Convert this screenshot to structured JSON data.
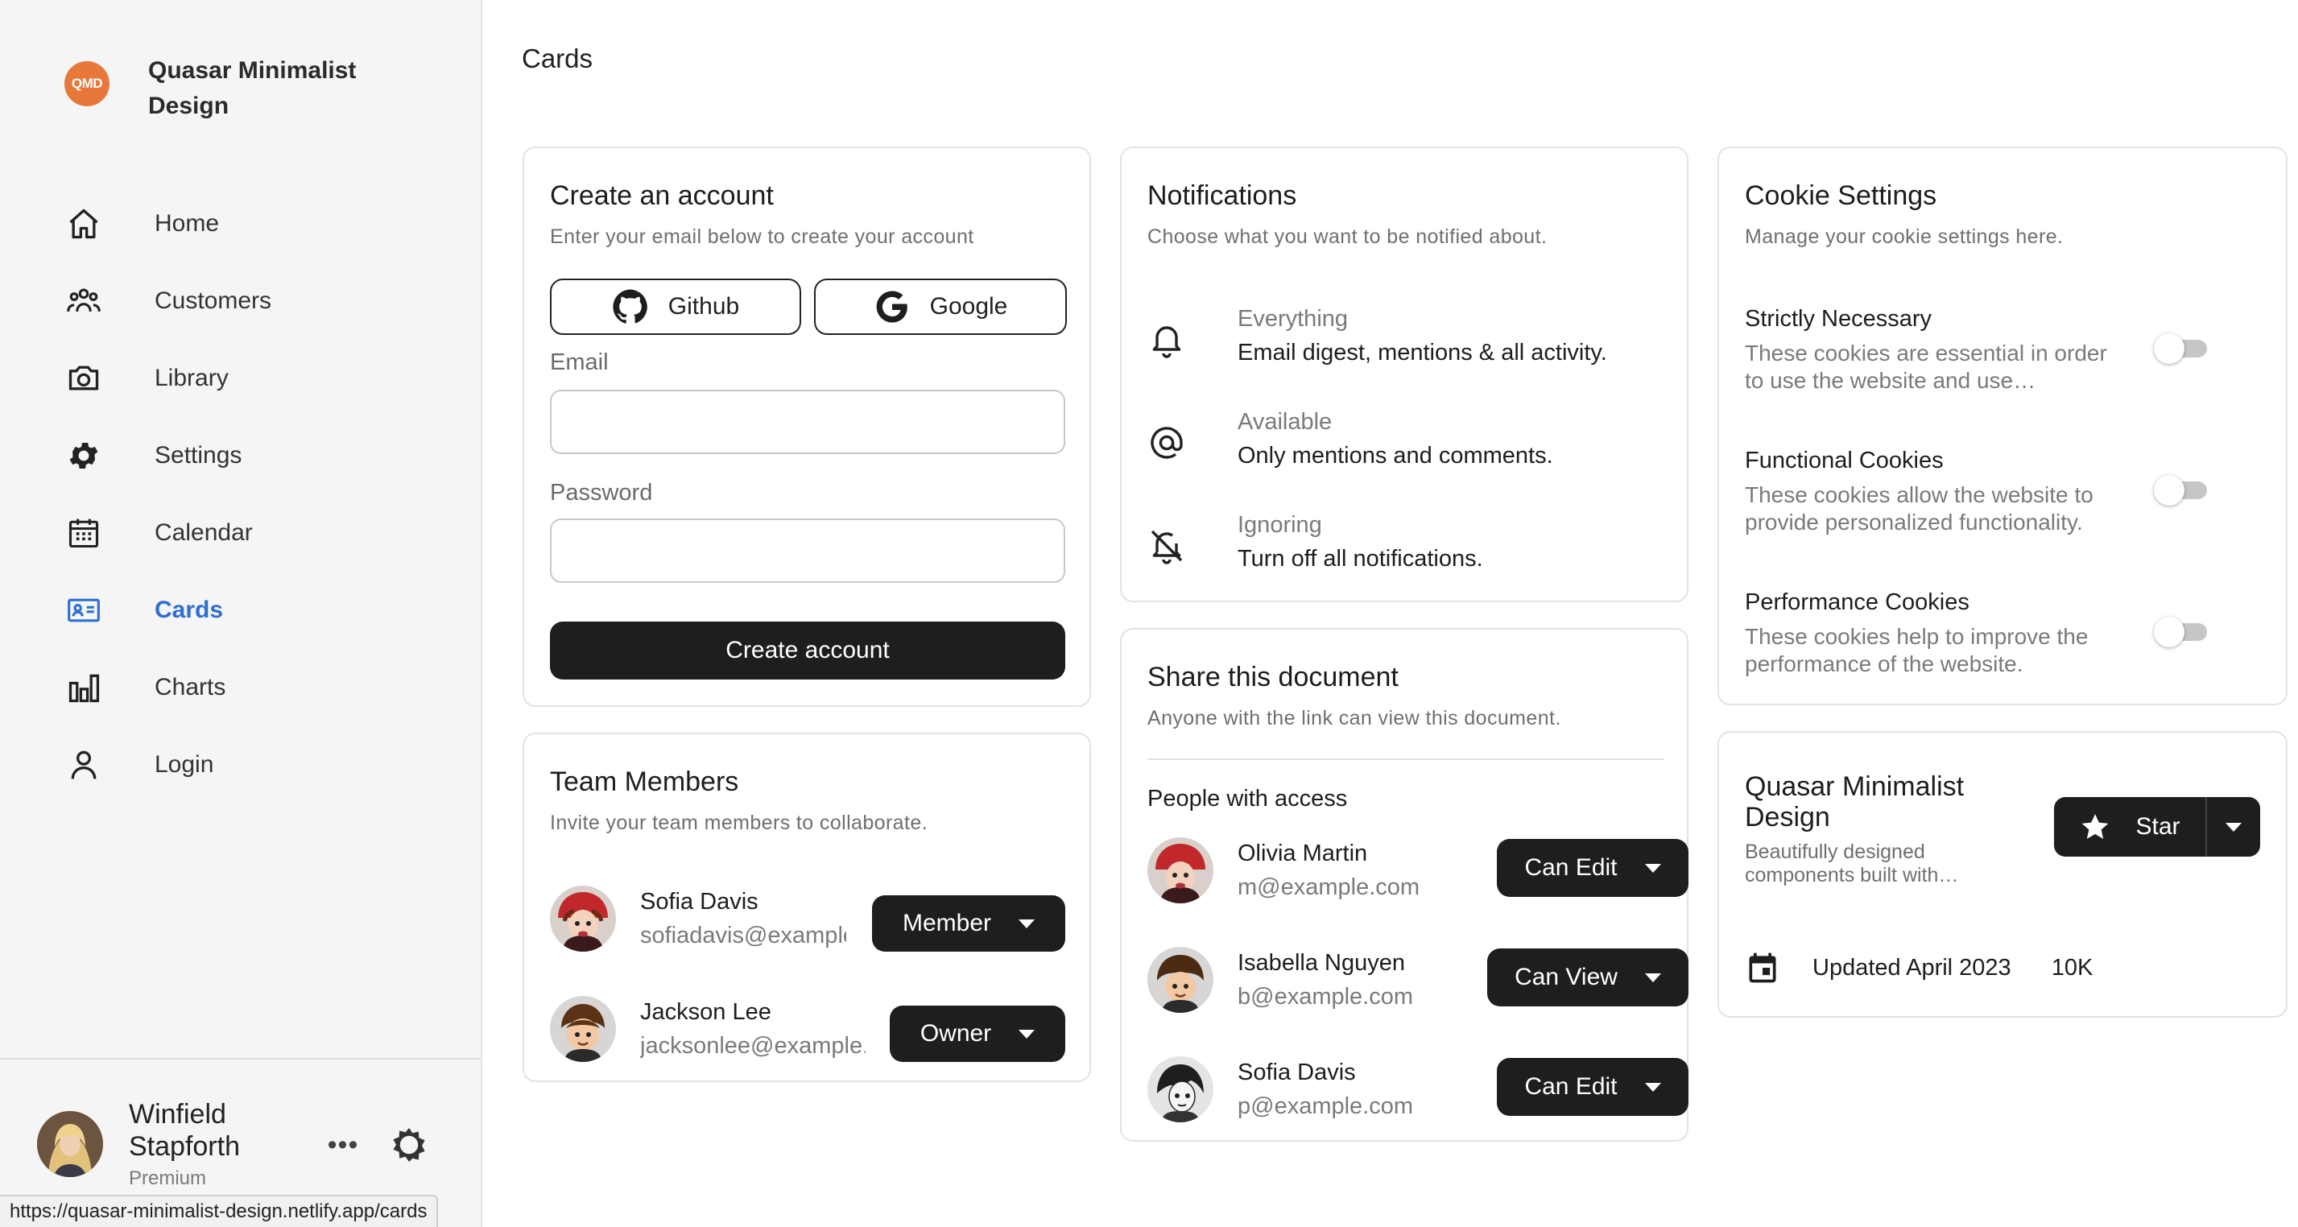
{
  "app": {
    "logo_text": "QMD",
    "brand_name": "Quasar Minimalist Design"
  },
  "sidebar": {
    "items": [
      {
        "label": "Home",
        "icon": "home-icon"
      },
      {
        "label": "Customers",
        "icon": "people-icon"
      },
      {
        "label": "Library",
        "icon": "camera-icon"
      },
      {
        "label": "Settings",
        "icon": "gear-icon"
      },
      {
        "label": "Calendar",
        "icon": "calendar-icon"
      },
      {
        "label": "Cards",
        "icon": "id-card-icon",
        "active": true
      },
      {
        "label": "Charts",
        "icon": "bar-chart-icon"
      },
      {
        "label": "Login",
        "icon": "person-icon"
      }
    ],
    "active_color": "#2f6fcf"
  },
  "user": {
    "name": "Winfield Stapforth",
    "plan": "Premium",
    "more_label": "•••"
  },
  "status_bar": {
    "url": "https://quasar-minimalist-design.netlify.app/cards"
  },
  "page": {
    "title": "Cards"
  },
  "create_account": {
    "title": "Create an account",
    "subtitle": "Enter your email below to create your account",
    "github_label": "Github",
    "google_label": "Google",
    "email_label": "Email",
    "email_value": "",
    "password_label": "Password",
    "password_value": "",
    "submit_label": "Create account"
  },
  "team": {
    "title": "Team Members",
    "subtitle": "Invite your team members to collaborate.",
    "members": [
      {
        "name": "Sofia Davis",
        "email": "sofiadavis@example.com",
        "role": "Member"
      },
      {
        "name": "Jackson Lee",
        "email": "jacksonlee@example.com",
        "role": "Owner"
      }
    ]
  },
  "notifications": {
    "title": "Notifications",
    "subtitle": "Choose what you want to be notified about.",
    "items": [
      {
        "heading": "Everything",
        "description": "Email digest, mentions & all activity.",
        "icon": "bell-icon"
      },
      {
        "heading": "Available",
        "description": "Only mentions and comments.",
        "icon": "at-sign-icon"
      },
      {
        "heading": "Ignoring",
        "description": "Turn off all notifications.",
        "icon": "bell-off-icon"
      }
    ]
  },
  "share": {
    "title": "Share this document",
    "subtitle": "Anyone with the link can view this document.",
    "people_heading": "People with access",
    "people": [
      {
        "name": "Olivia Martin",
        "email": "m@example.com",
        "permission": "Can Edit"
      },
      {
        "name": "Isabella Nguyen",
        "email": "b@example.com",
        "permission": "Can View"
      },
      {
        "name": "Sofia Davis",
        "email": "p@example.com",
        "permission": "Can Edit"
      }
    ]
  },
  "cookies": {
    "title": "Cookie Settings",
    "subtitle": "Manage your cookie settings here.",
    "items": [
      {
        "title": "Strictly Necessary",
        "description": "These cookies are essential in order to use the website and use…",
        "enabled": false
      },
      {
        "title": "Functional Cookies",
        "description": "These cookies allow the website to provide personalized functionality.",
        "enabled": false
      },
      {
        "title": "Performance Cookies",
        "description": "These cookies help to improve the performance of the website.",
        "enabled": false
      }
    ]
  },
  "repo": {
    "name": "Quasar Minimalist Design",
    "description": "Beautifully designed components built with…",
    "star_label": "Star",
    "updated": "Updated April 2023",
    "stars": "10K"
  }
}
